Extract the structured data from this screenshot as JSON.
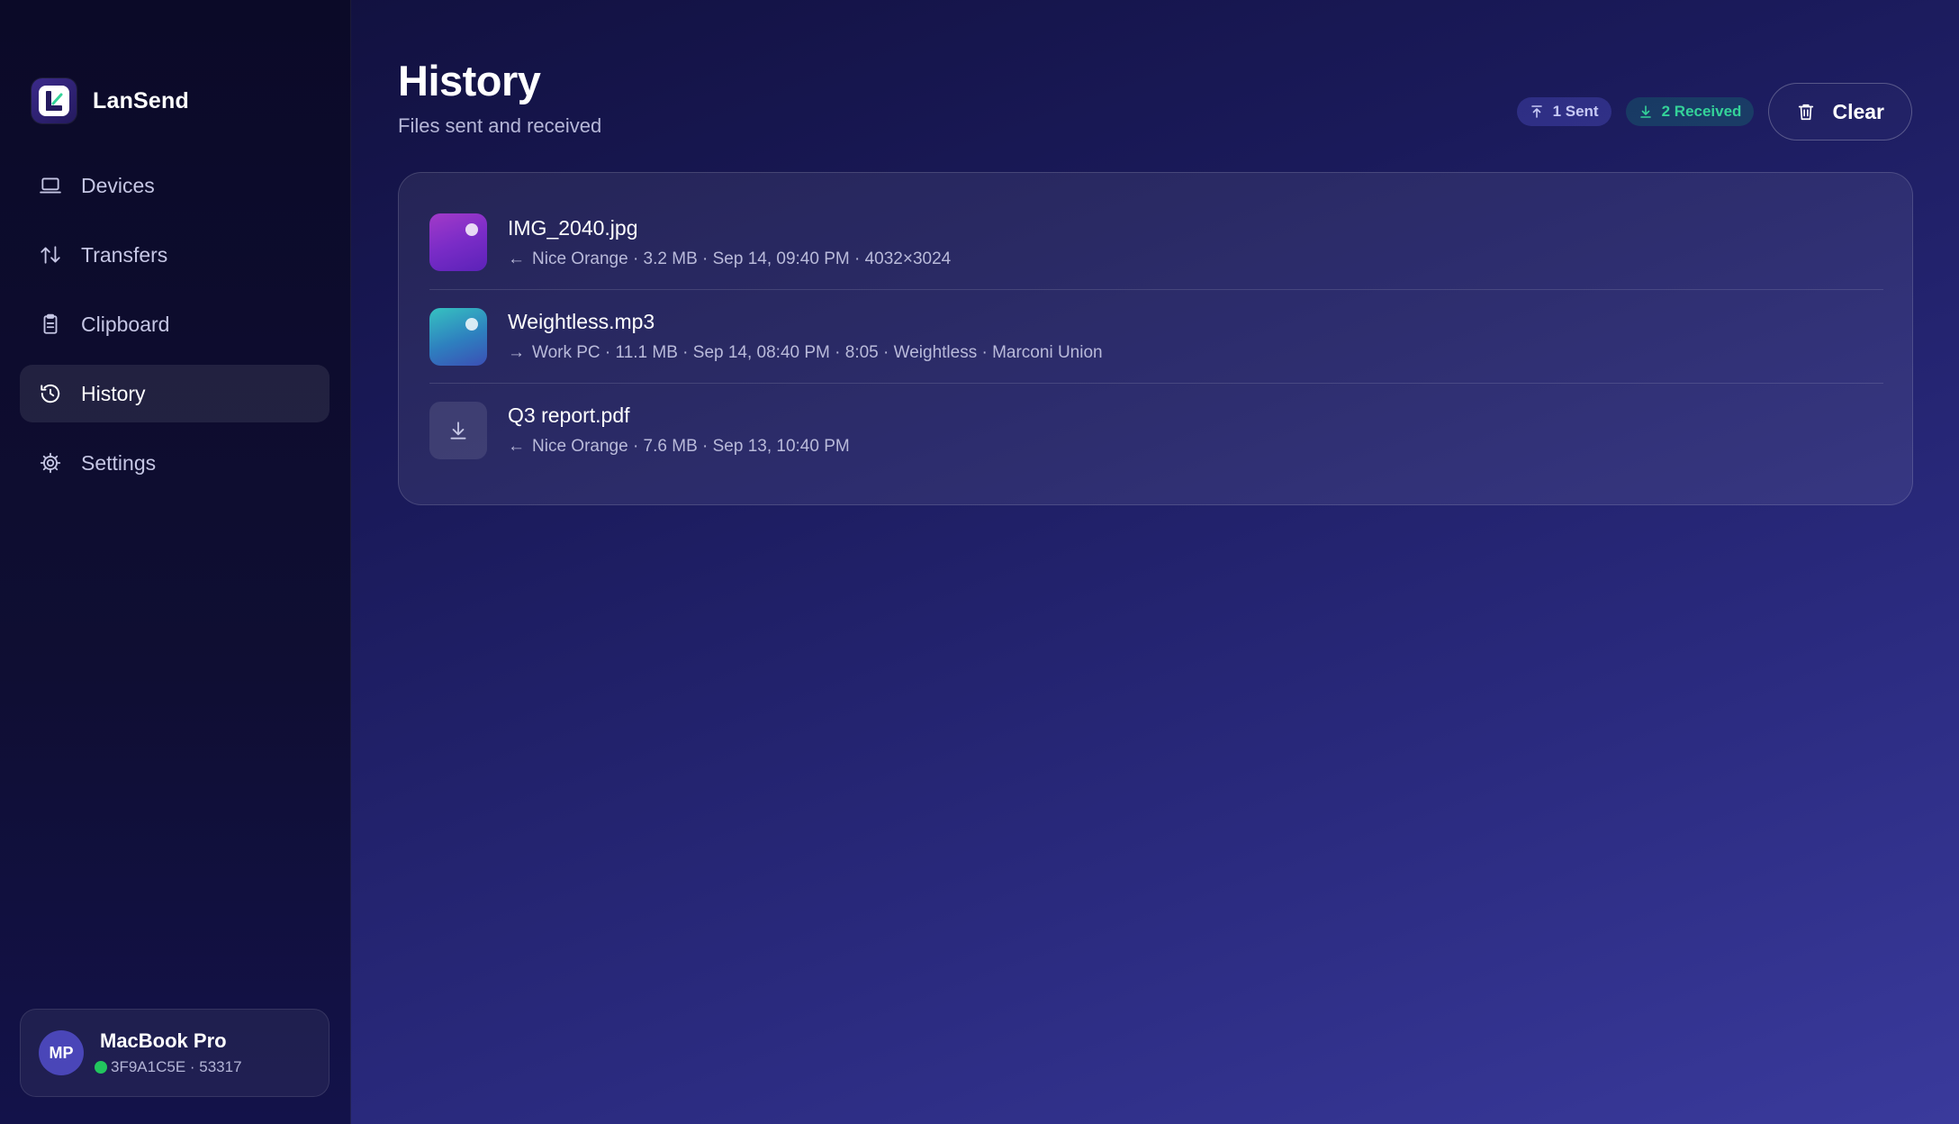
{
  "app": {
    "name": "LanSend"
  },
  "nav": {
    "items": [
      {
        "label": "Devices",
        "icon": "laptop-icon",
        "active": false
      },
      {
        "label": "Transfers",
        "icon": "transfer-arrows-icon",
        "active": false
      },
      {
        "label": "Clipboard",
        "icon": "clipboard-icon",
        "active": false
      },
      {
        "label": "History",
        "icon": "history-icon",
        "active": true
      },
      {
        "label": "Settings",
        "icon": "gear-icon",
        "active": false
      }
    ]
  },
  "device": {
    "initials": "MP",
    "name": "MacBook Pro",
    "info": "3F9A1C5E · 53317",
    "status_color": "#22c55e"
  },
  "page": {
    "title": "History",
    "subtitle": "Files sent and received"
  },
  "badges": {
    "sent": "1 Sent",
    "received": "2 Received"
  },
  "actions": {
    "clear_label": "Clear"
  },
  "history": [
    {
      "name": "IMG_2040.jpg",
      "direction": "←",
      "meta": "Nice Orange · 3.2 MB · Sep 14, 09:40 PM · 4032×3024",
      "kind": "image"
    },
    {
      "name": "Weightless.mp3",
      "direction": "→",
      "meta": "Work PC · 11.1 MB · Sep 14, 08:40 PM · 8:05 · Weightless · Marconi Union",
      "kind": "audio"
    },
    {
      "name": "Q3 report.pdf",
      "direction": "←",
      "meta": "Nice Orange · 7.6 MB · Sep 13, 10:40 PM",
      "kind": "document"
    }
  ],
  "colors": {
    "accent": "#4a46b8",
    "received": "#34d399",
    "sent": "#c7c9f5"
  }
}
